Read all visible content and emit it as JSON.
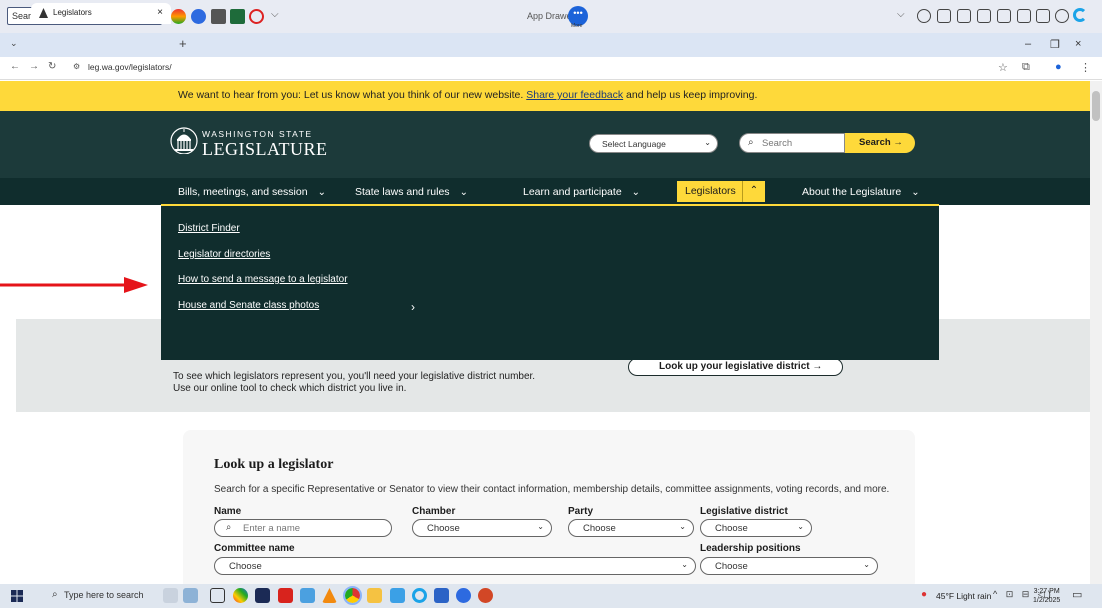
{
  "browser": {
    "websearch_placeholder": "Search the Web",
    "app_drawer": "App Drawer",
    "more_label": "More",
    "tab_title": "Legislators",
    "tab_close": "×",
    "new_tab": "+",
    "url": "leg.wa.gov/legislators/",
    "win_min": "–",
    "win_max": "❐",
    "win_close": "×"
  },
  "site": {
    "feedback_before": "We want to hear from you: Let us know what you think of our new website. ",
    "feedback_link": "Share your feedback",
    "feedback_after": " and help us keep improving.",
    "logo_top": "WASHINGTON STATE",
    "logo_main": "LEGISLATURE",
    "language_select": "Select Language",
    "search_placeholder": "Search",
    "search_button": "Search →",
    "nav": {
      "bills": "Bills, meetings, and session",
      "laws": "State laws and rules",
      "learn": "Learn and participate",
      "legislators": "Legislators",
      "about": "About the Legislature"
    },
    "dropdown": {
      "district_finder": "District Finder",
      "directories": "Legislator directories",
      "send_message": "How to send a message to a legislator",
      "class_photos": "House and Senate class photos"
    },
    "lookup_district_button": "Look up your legislative district →",
    "band_text_1": "To see which legislators represent you, you'll need your legislative district number.",
    "band_text_2": "Use our online tool to check which district you live in.",
    "card": {
      "title": "Look up a legislator",
      "description": "Search for a specific Representative or Senator to view their contact information, membership details, committee assignments, voting records, and more.",
      "name_label": "Name",
      "name_placeholder": "Enter a name",
      "chamber_label": "Chamber",
      "chamber_value": "Choose",
      "party_label": "Party",
      "party_value": "Choose",
      "district_label": "Legislative district",
      "district_value": "Choose",
      "committee_label": "Committee name",
      "committee_value": "Choose",
      "leadership_label": "Leadership positions",
      "leadership_value": "Choose"
    }
  },
  "taskbar": {
    "search_placeholder": "Type here to search",
    "weather": "45°F  Light rain",
    "time": "3:27 PM",
    "date": "1/2/2025"
  },
  "colors": {
    "accent_yellow": "#fed93a",
    "header_green": "#1c3a3a",
    "nav_green": "#102d2d",
    "red_arrow": "#e5141a"
  }
}
